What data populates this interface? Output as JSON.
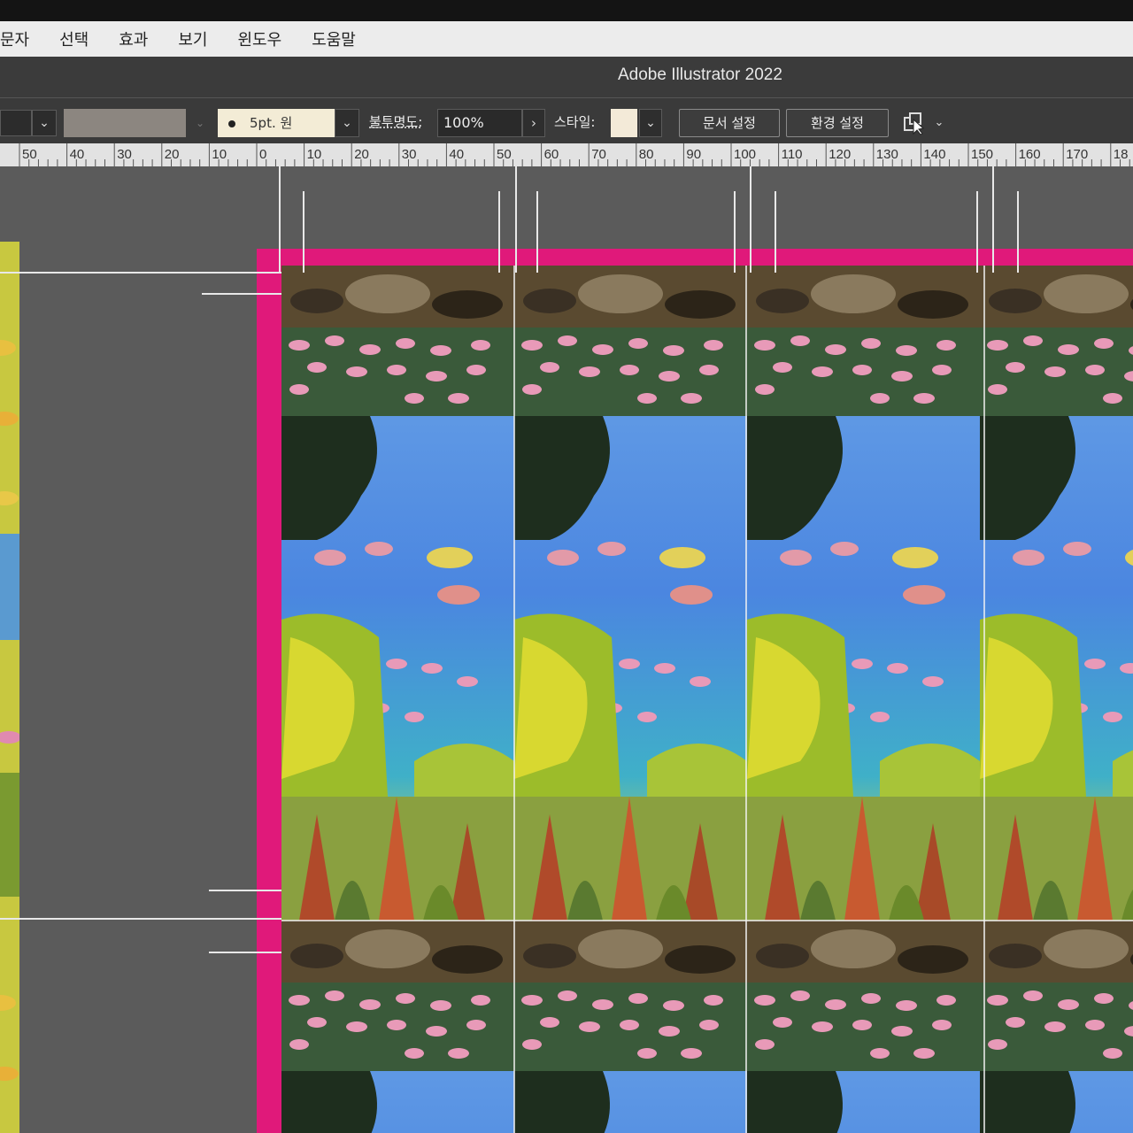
{
  "menubar": {
    "items": [
      "문자",
      "선택",
      "효과",
      "보기",
      "윈도우",
      "도움말"
    ]
  },
  "window": {
    "title": "Adobe Illustrator 2022"
  },
  "control_bar": {
    "brush": "5pt. 원",
    "opacity_label": "불투명도:",
    "opacity_value": "100%",
    "style_label": "스타일:",
    "document_setup": "문서 설정",
    "preferences": "환경 설정"
  },
  "ruler": {
    "labels": [
      "50",
      "40",
      "30",
      "20",
      "10",
      "0",
      "10",
      "20",
      "30",
      "40",
      "50",
      "60",
      "70",
      "80",
      "90",
      "100",
      "110",
      "120",
      "130",
      "140",
      "150",
      "160",
      "170",
      "18"
    ]
  },
  "colors": {
    "artboard_bleed": "#e0197a",
    "canvas": "#5b5b5b",
    "menubar": "#ececec",
    "titlebar": "#3b3b3b"
  },
  "icons": [
    "chevron-down-icon",
    "chevron-right-icon",
    "arrange-documents-icon"
  ]
}
